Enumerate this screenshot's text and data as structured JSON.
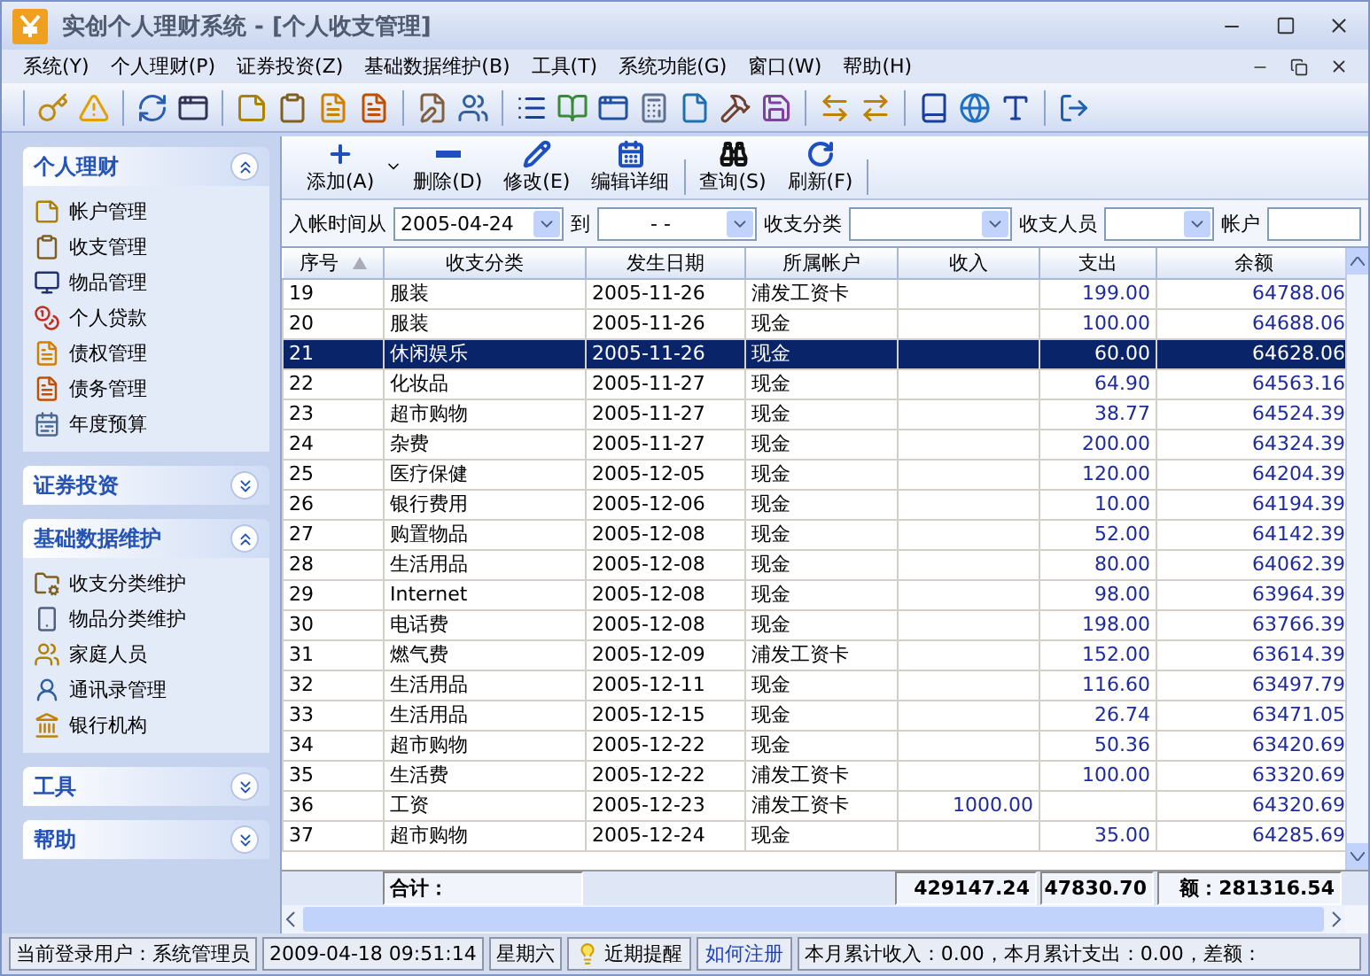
{
  "window": {
    "title": "实创个人理财系统 - [个人收支管理]"
  },
  "menu": [
    {
      "label": "系统(Y)"
    },
    {
      "label": "个人理财(P)"
    },
    {
      "label": "证券投资(Z)"
    },
    {
      "label": "基础数据维护(B)"
    },
    {
      "label": "工具(T)"
    },
    {
      "label": "系统功能(G)"
    },
    {
      "label": "窗口(W)"
    },
    {
      "label": "帮助(H)"
    }
  ],
  "sidebar": {
    "sections": [
      {
        "title": "个人理财",
        "expanded": true,
        "items": [
          {
            "label": "帐户管理"
          },
          {
            "label": "收支管理"
          },
          {
            "label": "物品管理"
          },
          {
            "label": "个人贷款"
          },
          {
            "label": "债权管理"
          },
          {
            "label": "债务管理"
          },
          {
            "label": "年度预算"
          }
        ]
      },
      {
        "title": "证券投资",
        "expanded": false
      },
      {
        "title": "基础数据维护",
        "expanded": true,
        "items": [
          {
            "label": "收支分类维护"
          },
          {
            "label": "物品分类维护"
          },
          {
            "label": "家庭人员"
          },
          {
            "label": "通讯录管理"
          },
          {
            "label": "银行机构"
          }
        ]
      },
      {
        "title": "工具",
        "expanded": false
      },
      {
        "title": "帮助",
        "expanded": false
      }
    ]
  },
  "actions": [
    {
      "label": "添加(A)",
      "kind": "split"
    },
    {
      "label": "删除(D)",
      "kind": "plain"
    },
    {
      "label": "修改(E)",
      "kind": "plain"
    },
    {
      "label": "编辑详细",
      "kind": "plain"
    },
    {
      "label": "查询(S)",
      "kind": "plain",
      "group_start": true
    },
    {
      "label": "刷新(F)",
      "kind": "plain"
    }
  ],
  "filters": {
    "from_label": "入帐时间从",
    "from_value": "2005-04-24",
    "to_label": "到",
    "to_value": "-   -",
    "category_label": "收支分类",
    "person_label": "收支人员",
    "account_label": "帐户"
  },
  "table": {
    "columns": [
      {
        "label": "序号",
        "sorted": true
      },
      {
        "label": "收支分类",
        "sorted": false
      },
      {
        "label": "发生日期",
        "sorted": false
      },
      {
        "label": "所属帐户",
        "sorted": false
      },
      {
        "label": "收入",
        "sorted": false
      },
      {
        "label": "支出",
        "sorted": false
      },
      {
        "label": "余额",
        "sorted": false
      }
    ],
    "rows": [
      {
        "no": "19",
        "category": "服装",
        "date": "2005-11-26",
        "account": "浦发工资卡",
        "expense": "199.00",
        "balance": "64788.06",
        "selected": false
      },
      {
        "no": "20",
        "category": "服装",
        "date": "2005-11-26",
        "account": "现金",
        "expense": "100.00",
        "balance": "64688.06",
        "selected": false
      },
      {
        "no": "21",
        "category": "休闲娱乐",
        "date": "2005-11-26",
        "account": "现金",
        "expense": "60.00",
        "balance": "64628.06",
        "selected": true
      },
      {
        "no": "22",
        "category": "化妆品",
        "date": "2005-11-27",
        "account": "现金",
        "expense": "64.90",
        "balance": "64563.16",
        "selected": false
      },
      {
        "no": "23",
        "category": "超市购物",
        "date": "2005-11-27",
        "account": "现金",
        "expense": "38.77",
        "balance": "64524.39",
        "selected": false
      },
      {
        "no": "24",
        "category": "杂费",
        "date": "2005-11-27",
        "account": "现金",
        "expense": "200.00",
        "balance": "64324.39",
        "selected": false
      },
      {
        "no": "25",
        "category": "医疗保健",
        "date": "2005-12-05",
        "account": "现金",
        "expense": "120.00",
        "balance": "64204.39",
        "selected": false
      },
      {
        "no": "26",
        "category": "银行费用",
        "date": "2005-12-06",
        "account": "现金",
        "expense": "10.00",
        "balance": "64194.39",
        "selected": false
      },
      {
        "no": "27",
        "category": "购置物品",
        "date": "2005-12-08",
        "account": "现金",
        "expense": "52.00",
        "balance": "64142.39",
        "selected": false
      },
      {
        "no": "28",
        "category": "生活用品",
        "date": "2005-12-08",
        "account": "现金",
        "expense": "80.00",
        "balance": "64062.39",
        "selected": false
      },
      {
        "no": "29",
        "category": "Internet",
        "date": "2005-12-08",
        "account": "现金",
        "expense": "98.00",
        "balance": "63964.39",
        "selected": false
      },
      {
        "no": "30",
        "category": "电话费",
        "date": "2005-12-08",
        "account": "现金",
        "expense": "198.00",
        "balance": "63766.39",
        "selected": false
      },
      {
        "no": "31",
        "category": "燃气费",
        "date": "2005-12-09",
        "account": "浦发工资卡",
        "expense": "152.00",
        "balance": "63614.39",
        "selected": false
      },
      {
        "no": "32",
        "category": "生活用品",
        "date": "2005-12-11",
        "account": "现金",
        "expense": "116.60",
        "balance": "63497.79",
        "selected": false
      },
      {
        "no": "33",
        "category": "生活用品",
        "date": "2005-12-15",
        "account": "现金",
        "expense": "26.74",
        "balance": "63471.05",
        "selected": false
      },
      {
        "no": "34",
        "category": "超市购物",
        "date": "2005-12-22",
        "account": "现金",
        "expense": "50.36",
        "balance": "63420.69",
        "selected": false
      },
      {
        "no": "35",
        "category": "生活费",
        "date": "2005-12-22",
        "account": "浦发工资卡",
        "expense": "100.00",
        "balance": "63320.69",
        "selected": false
      },
      {
        "no": "36",
        "category": "工资",
        "date": "2005-12-23",
        "account": "浦发工资卡",
        "income": "1000.00",
        "balance": "64320.69",
        "selected": false
      },
      {
        "no": "37",
        "category": "超市购物",
        "date": "2005-12-24",
        "account": "现金",
        "expense": "35.00",
        "balance": "64285.69",
        "selected": false
      }
    ],
    "totals": {
      "label": "合计：",
      "income": "429147.24",
      "expense": "47830.70",
      "balance": "额：281316.54"
    }
  },
  "status_bar": {
    "user": "当前登录用户：系统管理员",
    "datetime": "2009-04-18 09:51:14",
    "weekday": "星期六",
    "reminder": "近期提醒",
    "register_link": "如何注册",
    "summary": "本月累计收入：0.00，本月累计支出：0.00，差额："
  }
}
